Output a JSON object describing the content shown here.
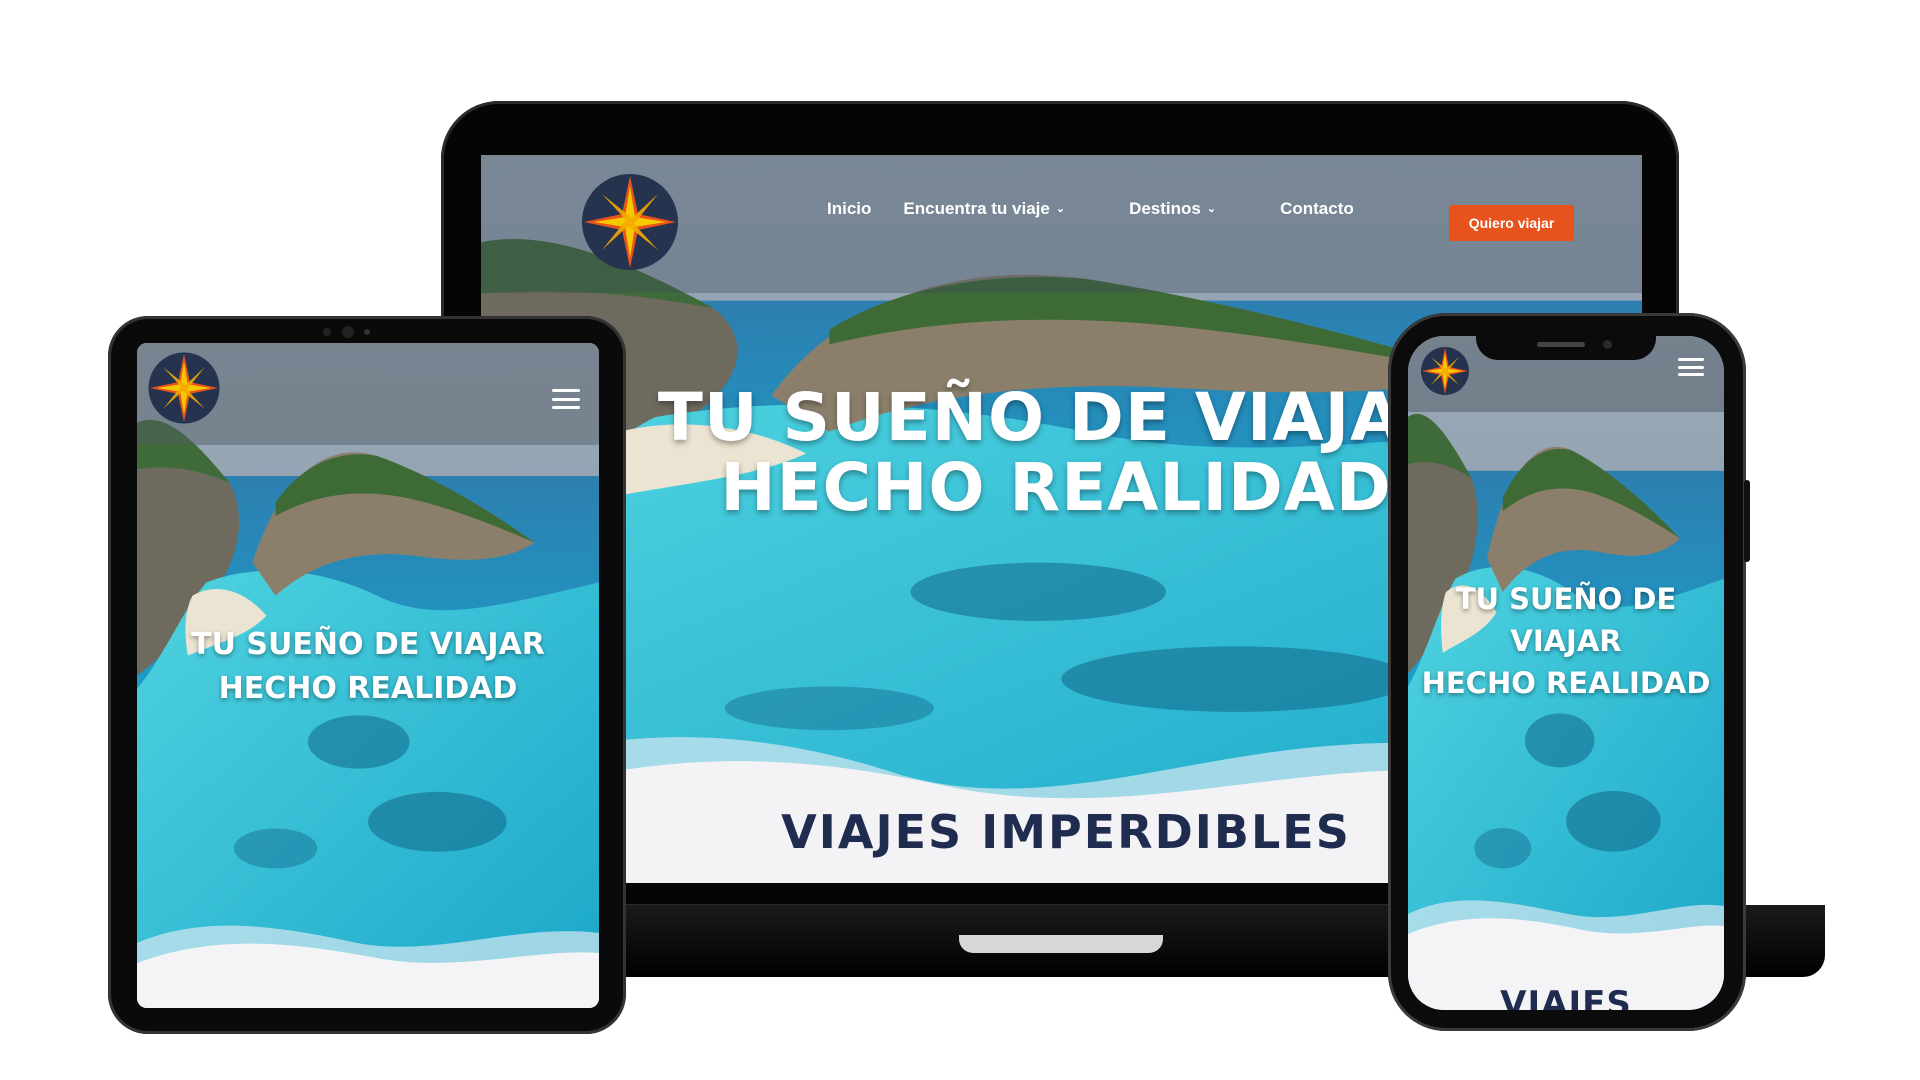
{
  "brand": {
    "logo_icon": "compass-star-icon",
    "colors": {
      "accent": "#e8531d",
      "navy": "#1f2c4f",
      "star": "#f6a800"
    }
  },
  "desktop": {
    "nav": {
      "items": [
        {
          "label": "Inicio",
          "has_dropdown": false
        },
        {
          "label": "Encuentra tu viaje",
          "has_dropdown": true
        },
        {
          "label": "Destinos",
          "has_dropdown": true
        },
        {
          "label": "Contacto",
          "has_dropdown": false
        }
      ],
      "cta_label": "Quiero viajar"
    },
    "hero": {
      "line1": "TU SUEÑO DE VIAJAR",
      "line2": "HECHO REALIDAD"
    },
    "section_title": "VIAJES IMPERDIBLES"
  },
  "tablet": {
    "menu_icon": "hamburger-menu-icon",
    "hero": {
      "line1": "TU SUEÑO DE VIAJAR",
      "line2": "HECHO REALIDAD"
    }
  },
  "mobile": {
    "menu_icon": "hamburger-menu-icon",
    "hero": {
      "line1": "TU SUEÑO DE",
      "line2": "VIAJAR",
      "line3": "HECHO REALIDAD"
    },
    "section_title": "VIAJES"
  }
}
